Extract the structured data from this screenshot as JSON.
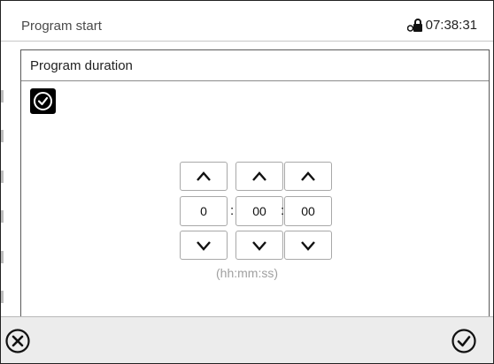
{
  "header": {
    "title": "Program start",
    "time": "07:38:31",
    "status_icon": "lock-icon"
  },
  "dialog": {
    "title": "Program duration",
    "icon": "clock-icon",
    "fields": {
      "hours": "0",
      "minutes": "00",
      "seconds": "00"
    },
    "separator": ":",
    "format_hint": "(hh:mm:ss)"
  },
  "footer": {
    "cancel_icon": "cancel-icon",
    "confirm_icon": "confirm-icon"
  },
  "colors": {
    "border": "#a8a8a8",
    "footer_bg": "#ececec",
    "hint_text": "#a0a0a0"
  }
}
